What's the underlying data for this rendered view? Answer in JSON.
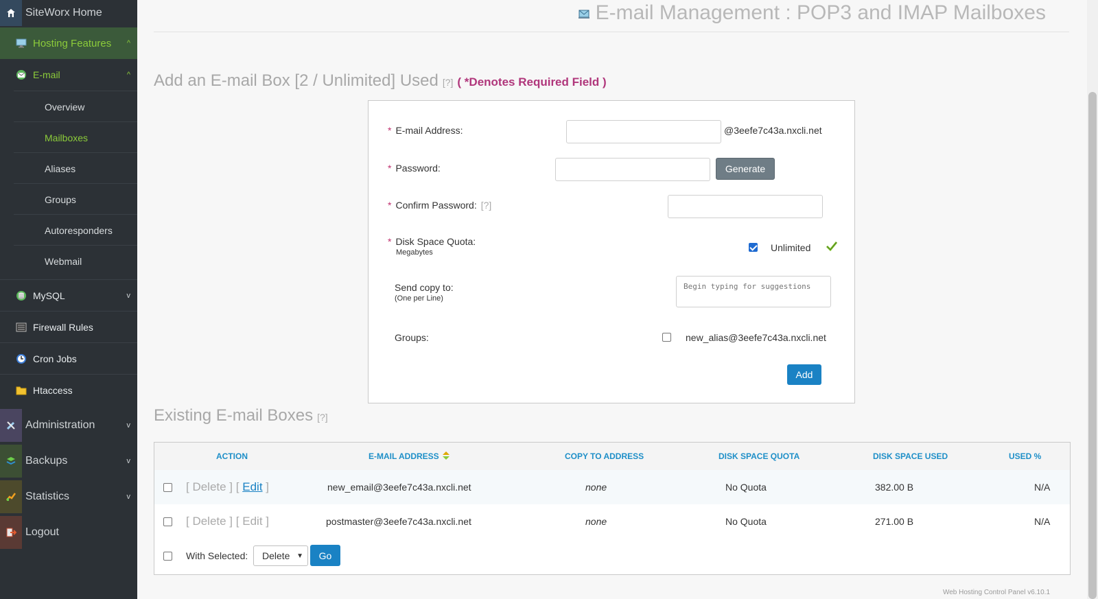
{
  "sidebar": {
    "home": "SiteWorx Home",
    "hosting_features": "Hosting Features",
    "email": "E-mail",
    "email_sub": [
      "Overview",
      "Mailboxes",
      "Aliases",
      "Groups",
      "Autoresponders",
      "Webmail"
    ],
    "mysql": "MySQL",
    "firewall": "Firewall Rules",
    "cron": "Cron Jobs",
    "htaccess": "Htaccess",
    "administration": "Administration",
    "backups": "Backups",
    "statistics": "Statistics",
    "logout": "Logout",
    "active_sub": "Mailboxes"
  },
  "page": {
    "title": "E-mail Management : POP3 and IMAP Mailboxes"
  },
  "add_form": {
    "title": "Add an E-mail Box [2 / Unlimited] Used",
    "help": "[?]",
    "required_note": "( *Denotes Required Field )",
    "email_label": "E-mail Address:",
    "domain_suffix": "@3eefe7c43a.nxcli.net",
    "password_label": "Password:",
    "generate_label": "Generate",
    "confirm_label": "Confirm Password:",
    "quota_label": "Disk Space Quota:",
    "quota_sub": "Megabytes",
    "unlimited_label": "Unlimited",
    "send_copy_label": "Send copy to:",
    "send_copy_sub": "(One per Line)",
    "send_copy_placeholder": "Begin typing for suggestions",
    "groups_label": "Groups:",
    "group_option": "new_alias@3eefe7c43a.nxcli.net",
    "add_label": "Add",
    "star": "*"
  },
  "existing": {
    "title": "Existing E-mail Boxes",
    "help": "[?]",
    "columns": [
      "ACTION",
      "E-MAIL ADDRESS",
      "COPY TO ADDRESS",
      "DISK SPACE QUOTA",
      "DISK SPACE USED",
      "USED %"
    ],
    "rows": [
      {
        "delete": "[ Delete ]",
        "edit": "Edit",
        "email": "new_email@3eefe7c43a.nxcli.net",
        "copy": "none",
        "quota": "No Quota",
        "used": "382.00 B",
        "pct": "N/A"
      },
      {
        "delete": "[ Delete ]",
        "edit": "Edit",
        "email": "postmaster@3eefe7c43a.nxcli.net",
        "copy": "none",
        "quota": "No Quota",
        "used": "271.00 B",
        "pct": "N/A"
      }
    ],
    "with_selected": "With Selected:",
    "action_select": "Delete",
    "go_label": "Go"
  },
  "footer": {
    "version": "Web Hosting Control Panel v6.10.1"
  },
  "colors": {
    "sidebar_bg": "#2c3136",
    "accent_green": "#8ccc3a",
    "link_blue": "#1a82c4",
    "required_magenta": "#b0367b"
  }
}
